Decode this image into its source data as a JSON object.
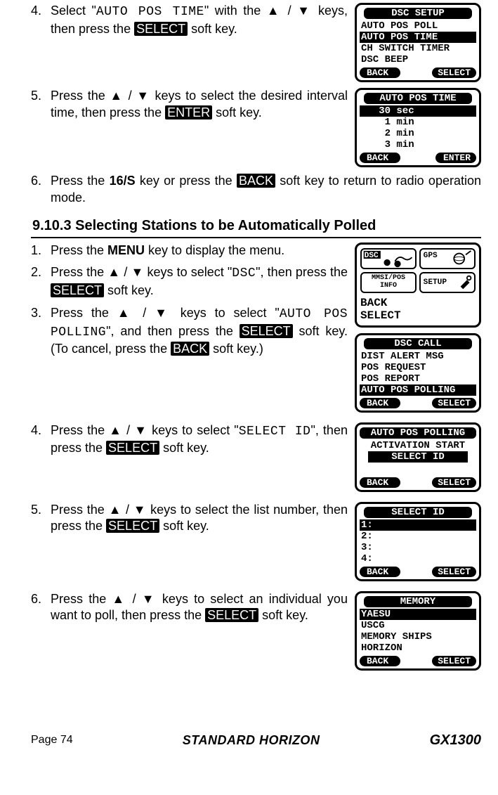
{
  "steps_top": {
    "s4": {
      "num": "4.",
      "pre": "Select \"",
      "code": "AUTO POS TIME",
      "mid": "\" with the ",
      "up": "▲",
      "slash": " / ",
      "down": "▼",
      "post": " keys, then press the ",
      "key": "SELECT",
      "end": " soft key."
    },
    "s5": {
      "num": "5.",
      "pre": "Press the ",
      "up": "▲",
      "slash": " / ",
      "down": "▼",
      "mid": " keys to select the desired interval time, then press the ",
      "key": "ENTER",
      "end": " soft key."
    },
    "s6": {
      "num": "6.",
      "pre": "Press the ",
      "key1": "16/S",
      "mid": " key or press the ",
      "key2": "BACK",
      "end": " soft key to return to radio operation mode."
    }
  },
  "section_heading": "9.10.3  Selecting Stations to be Automatically Polled",
  "steps_bottom": {
    "s1": {
      "num": "1.",
      "pre": "Press the ",
      "key": "MENU",
      "end": " key to display the menu."
    },
    "s2": {
      "num": "2.",
      "pre": "Press the ",
      "up": "▲",
      "slash": " / ",
      "down": "▼",
      "mid": " keys to select \"",
      "code": "DSC",
      "post": "\", then press the ",
      "key": "SELECT",
      "end": " soft key."
    },
    "s3": {
      "num": "3.",
      "pre": "Press the ",
      "up": "▲",
      "slash": " / ",
      "down": "▼",
      "mid": " keys to select \"",
      "code": "AUTO POS POLLING",
      "post": "\", and then press the ",
      "key": "SELECT",
      "end_a": " soft key. (To cancel, press the ",
      "key2": "BACK",
      "end_b": " soft key.)"
    },
    "s4": {
      "num": "4.",
      "pre": "Press the ",
      "up": "▲",
      "slash": " / ",
      "down": "▼",
      "mid": " keys to select \"",
      "code": "SELECT ID",
      "post": "\", then press the ",
      "key": "SELECT",
      "end": " soft key."
    },
    "s5": {
      "num": "5.",
      "pre": "Press the ",
      "up": "▲",
      "slash": " / ",
      "down": "▼",
      "mid": " keys to select the list number, then press the ",
      "key": "SELECT",
      "end": " soft key."
    },
    "s6": {
      "num": "6.",
      "pre": "Press the ",
      "up": "▲",
      "slash": " / ",
      "down": "▼",
      "mid": " keys to select an individual you want to poll, then press the ",
      "key": "SELECT",
      "end": " soft key."
    }
  },
  "screens": {
    "dsc_setup": {
      "title": "DSC SETUP",
      "lines": [
        "AUTO POS POLL",
        "AUTO POS TIME",
        "CH SWITCH TIMER",
        "DSC BEEP"
      ],
      "sel": 1,
      "back": "BACK",
      "right": "SELECT"
    },
    "auto_pos_time": {
      "title": "AUTO POS TIME",
      "lines": [
        "   30 sec",
        "    1 min",
        "    2 min",
        "    3 min"
      ],
      "sel": 0,
      "back": "BACK",
      "right": "ENTER"
    },
    "menu": {
      "cells": [
        "DSC",
        "GPS",
        "MMSI/POS INFO",
        "SETUP"
      ],
      "back": "BACK",
      "right": "SELECT"
    },
    "dsc_call": {
      "title": "DSC CALL",
      "lines": [
        "DIST ALERT MSG",
        "POS REQUEST",
        "POS REPORT",
        "AUTO POS POLLING"
      ],
      "sel": 3,
      "back": "BACK",
      "right": "SELECT"
    },
    "auto_pos_polling": {
      "title": "AUTO POS POLLING",
      "lines": [
        "ACTIVATION START",
        "   SELECT ID   "
      ],
      "sel": 1,
      "back": "BACK",
      "right": "SELECT"
    },
    "select_id": {
      "title": "SELECT ID",
      "lines": [
        "1:",
        "2:",
        "3:",
        "4:"
      ],
      "sel": 0,
      "back": "BACK",
      "right": "SELECT"
    },
    "memory": {
      "title": "MEMORY",
      "lines": [
        "YAESU",
        "USCG",
        "MEMORY SHIPS",
        "HORIZON"
      ],
      "sel": 0,
      "back": "BACK",
      "right": "SELECT"
    }
  },
  "footer": {
    "page": "Page 74",
    "brand": "STANDARD HORIZON",
    "model": "GX1300"
  }
}
